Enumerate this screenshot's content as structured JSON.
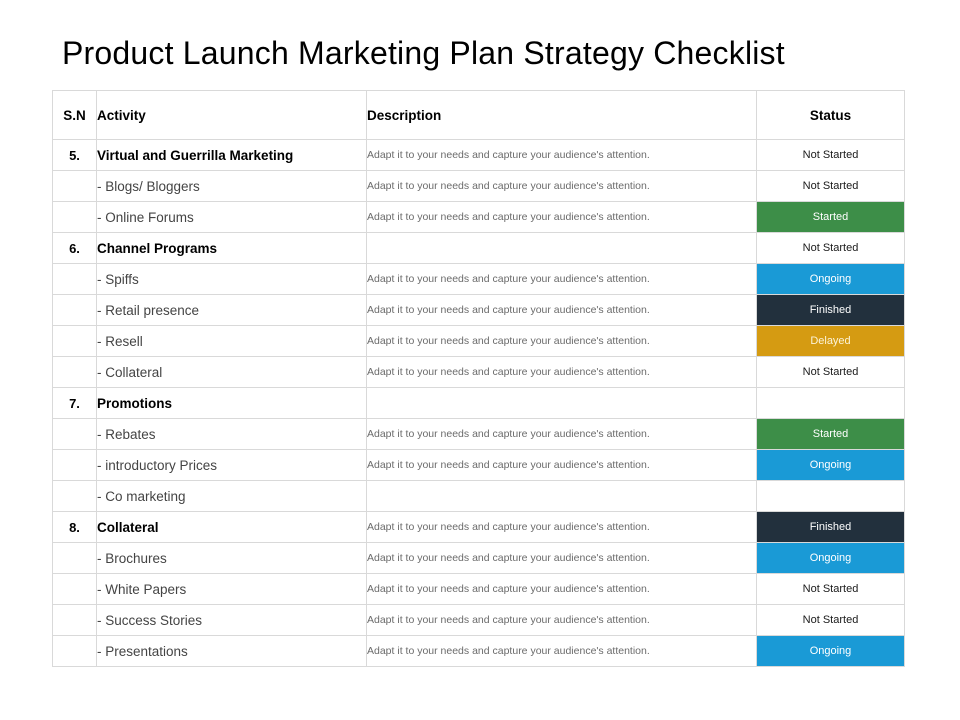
{
  "page": {
    "title": "Product Launch Marketing Plan Strategy Checklist",
    "background_color": "#ffffff"
  },
  "table": {
    "columns": [
      {
        "key": "sn",
        "label": "S.N"
      },
      {
        "key": "activity",
        "label": "Activity"
      },
      {
        "key": "description",
        "label": "Description"
      },
      {
        "key": "status",
        "label": "Status"
      }
    ],
    "status_colors": {
      "Not Started": "#ffffff",
      "Started": "#3d8e48",
      "Ongoing": "#1a9ad6",
      "Finished": "#22303d",
      "Delayed": "#d59b12"
    },
    "rows": [
      {
        "sn": "5.",
        "activity": "Virtual and Guerrilla Marketing",
        "level": "main",
        "description": "Adapt it to your needs and capture your audience's attention.",
        "status": "Not Started",
        "status_variant": "none"
      },
      {
        "sn": "",
        "activity": "- Blogs/ Bloggers",
        "level": "sub",
        "description": "Adapt it to your needs and capture your audience's attention.",
        "status": "Not Started",
        "status_variant": "none"
      },
      {
        "sn": "",
        "activity": "- Online Forums",
        "level": "sub",
        "description": "Adapt it to your needs and capture your audience's attention.",
        "status": "Started",
        "status_variant": "started"
      },
      {
        "sn": "6.",
        "activity": "Channel Programs",
        "level": "main",
        "description": "",
        "status": "Not Started",
        "status_variant": "none"
      },
      {
        "sn": "",
        "activity": "- Spiffs",
        "level": "sub",
        "description": "Adapt it to your needs and capture your audience's attention.",
        "status": "Ongoing",
        "status_variant": "ongoing"
      },
      {
        "sn": "",
        "activity": "- Retail presence",
        "level": "sub",
        "description": "Adapt it to your needs and capture your audience's attention.",
        "status": "Finished",
        "status_variant": "finished"
      },
      {
        "sn": "",
        "activity": "- Resell",
        "level": "sub",
        "description": "Adapt it to your needs and capture your audience's attention.",
        "status": "Delayed",
        "status_variant": "delayed"
      },
      {
        "sn": "",
        "activity": "- Collateral",
        "level": "sub",
        "description": "Adapt it to your needs and capture your audience's attention.",
        "status": "Not Started",
        "status_variant": "none"
      },
      {
        "sn": "7.",
        "activity": "Promotions",
        "level": "main",
        "description": "",
        "status": "",
        "status_variant": "empty"
      },
      {
        "sn": "",
        "activity": "- Rebates",
        "level": "sub",
        "description": "Adapt it to your needs and capture your audience's attention.",
        "status": "Started",
        "status_variant": "started"
      },
      {
        "sn": "",
        "activity": "- introductory Prices",
        "level": "sub",
        "description": "Adapt it to your needs and capture your audience's attention.",
        "status": "Ongoing",
        "status_variant": "ongoing"
      },
      {
        "sn": "",
        "activity": "- Co marketing",
        "level": "sub",
        "description": "",
        "status": "",
        "status_variant": "empty"
      },
      {
        "sn": "8.",
        "activity": "Collateral",
        "level": "main",
        "description": "Adapt it to your needs and capture your audience's attention.",
        "status": "Finished",
        "status_variant": "finished"
      },
      {
        "sn": "",
        "activity": "- Brochures",
        "level": "sub",
        "description": "Adapt it to your needs and capture your audience's attention.",
        "status": "Ongoing",
        "status_variant": "ongoing"
      },
      {
        "sn": "",
        "activity": "- White Papers",
        "level": "sub",
        "description": "Adapt it to your needs and capture your audience's attention.",
        "status": "Not Started",
        "status_variant": "none"
      },
      {
        "sn": "",
        "activity": "- Success Stories",
        "level": "sub",
        "description": "Adapt it to your needs and capture your audience's attention.",
        "status": "Not Started",
        "status_variant": "none"
      },
      {
        "sn": "",
        "activity": "- Presentations",
        "level": "sub",
        "description": "Adapt it to your needs and capture your audience's attention.",
        "status": "Ongoing",
        "status_variant": "ongoing"
      }
    ]
  }
}
